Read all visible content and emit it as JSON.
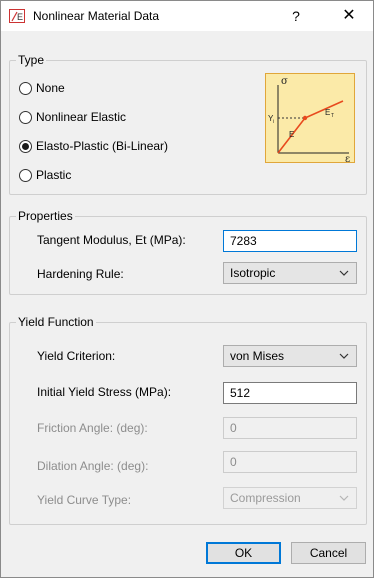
{
  "window": {
    "title": "Nonlinear Material Data",
    "help": "?",
    "close": "✕",
    "icon": "material-e-icon"
  },
  "type_group": {
    "legend": "Type",
    "options": [
      {
        "label": "None",
        "checked": false
      },
      {
        "label": "Nonlinear Elastic",
        "checked": false
      },
      {
        "label": "Elasto-Plastic (Bi-Linear)",
        "checked": true
      },
      {
        "label": "Plastic",
        "checked": false
      }
    ],
    "diagram": {
      "sigma": "σ",
      "epsilon": "ε",
      "yield_label": "Y",
      "yield_sub": "i",
      "e_label": "E",
      "et_label": "E",
      "et_sub": "T",
      "curve_color": "#e84a1e",
      "bg_color": "#fbeaa8",
      "border_color": "#e0a63a"
    }
  },
  "properties": {
    "legend": "Properties",
    "tangent_label": "Tangent Modulus, Et (MPa):",
    "tangent_value": "7283",
    "hardening_label": "Hardening Rule:",
    "hardening_value": "Isotropic"
  },
  "yield": {
    "legend": "Yield Function",
    "criterion_label": "Yield Criterion:",
    "criterion_value": "von Mises",
    "initial_label": "Initial Yield Stress (MPa):",
    "initial_value": "512",
    "friction_label": "Friction Angle: (deg):",
    "friction_value": "0",
    "dilation_label": "Dilation Angle: (deg):",
    "dilation_value": "0",
    "curve_label": "Yield Curve Type:",
    "curve_value": "Compression"
  },
  "buttons": {
    "ok": "OK",
    "cancel": "Cancel"
  }
}
